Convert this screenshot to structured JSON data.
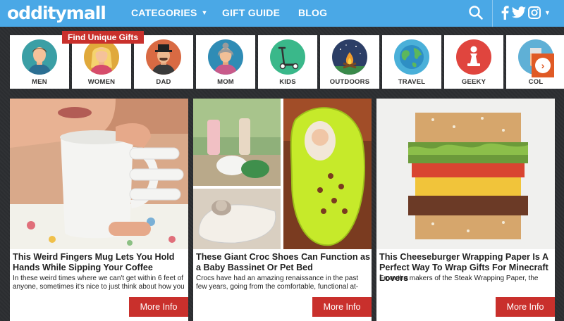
{
  "header": {
    "logo": "odditymall",
    "nav": [
      {
        "label": "CATEGORIES",
        "has_dropdown": true
      },
      {
        "label": "GIFT GUIDE"
      },
      {
        "label": "BLOG"
      }
    ],
    "social": [
      "facebook-icon",
      "twitter-icon",
      "instagram-icon"
    ],
    "colors": {
      "bar": "#4aa8e6",
      "accent": "#c9302c",
      "arrow": "#e05a25"
    }
  },
  "find_badge": "Find Unique Gifts",
  "categories": [
    {
      "label": "MEN",
      "icon": "man-avatar-icon",
      "bg": "#3b9fa5"
    },
    {
      "label": "WOMEN",
      "icon": "woman-avatar-icon",
      "bg": "#e0a93b"
    },
    {
      "label": "DAD",
      "icon": "dad-avatar-icon",
      "bg": "#d96a43"
    },
    {
      "label": "MOM",
      "icon": "mom-avatar-icon",
      "bg": "#2f8cb5"
    },
    {
      "label": "KIDS",
      "icon": "scooter-icon",
      "bg": "#3ab88a"
    },
    {
      "label": "OUTDOORS",
      "icon": "campfire-icon",
      "bg": "#2c3e66"
    },
    {
      "label": "TRAVEL",
      "icon": "globe-icon",
      "bg": "#4ab0d9"
    },
    {
      "label": "GEEKY",
      "icon": "chess-piece-icon",
      "bg": "#e0453e"
    },
    {
      "label": "COL",
      "icon": "collectibles-icon",
      "bg": "#5fb0d6"
    }
  ],
  "cards": [
    {
      "title": "This Weird Fingers Mug Lets You Hold Hands While Sipping Your Coffee",
      "desc": "In these weird times where we can't get within 6 feet of anyone, sometimes it's nice to just think about how you",
      "more": "More Info"
    },
    {
      "title": "These Giant Croc Shoes Can Function as a Baby Bassinet Or Pet Bed",
      "desc": "Crocs have had an amazing renaissance in the past few years, going from the comfortable, functional at-home",
      "more": "More Info"
    },
    {
      "title": "This Cheeseburger Wrapping Paper Is A Perfect Way To Wrap Gifts For Minecraft Lovers",
      "desc": "From the makers of the Steak Wrapping Paper, the",
      "more": "More Info"
    }
  ]
}
